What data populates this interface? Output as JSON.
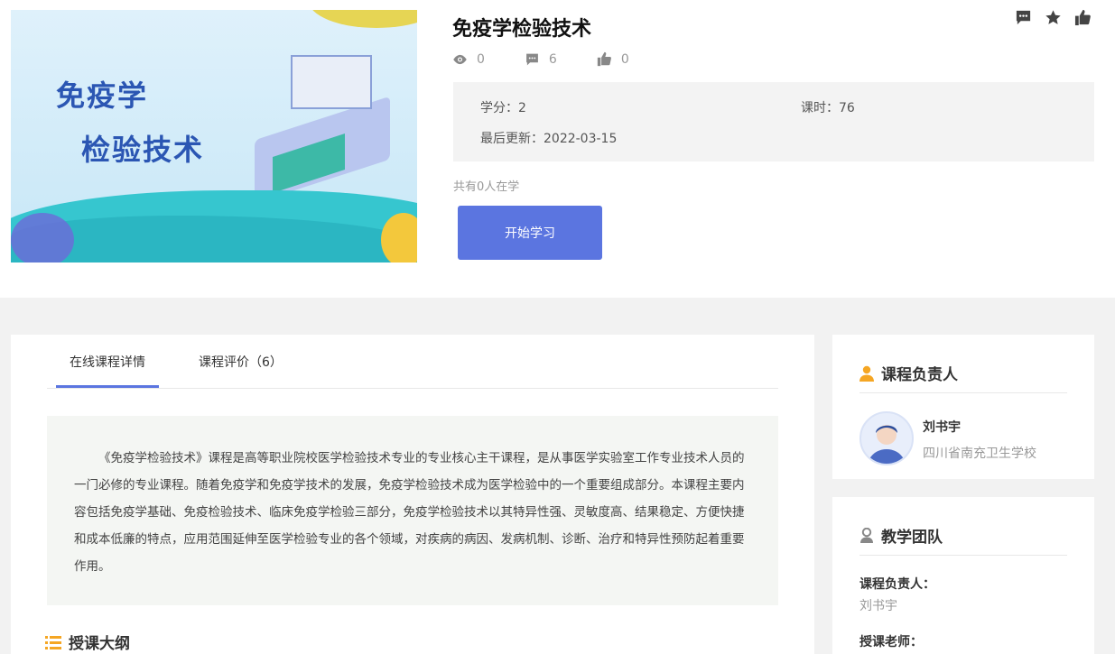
{
  "course": {
    "cover_title_line1": "免疫学",
    "cover_title_line2": "检验技术",
    "title": "免疫学检验技术",
    "stats": {
      "views": "0",
      "comments": "6",
      "likes": "0"
    },
    "credits_label": "学分：2",
    "hours_label": "课时：76",
    "updated_label": "最后更新：2022-03-15",
    "learners_text": "共有0人在学",
    "start_button": "开始学习"
  },
  "tabs": [
    {
      "label": "在线课程详情"
    },
    {
      "label": "课程评价（6）"
    }
  ],
  "description": "《免疫学检验技术》课程是高等职业院校医学检验技术专业的专业核心主干课程，是从事医学实验室工作专业技术人员的一门必修的专业课程。随着免疫学和免疫学技术的发展，免疫学检验技术成为医学检验中的一个重要组成部分。本课程主要内容包括免疫学基础、免疫检验技术、临床免疫学检验三部分，免疫学检验技术以其特异性强、灵敏度高、结果稳定、方便快捷和成本低廉的特点，应用范围延伸至医学检验专业的各个领域，对疾病的病因、发病机制、诊断、治疗和特异性预防起着重要作用。",
  "outline_title": "授课大纲",
  "owner": {
    "heading": "课程负责人",
    "name": "刘书宇",
    "school": "四川省南充卫生学校"
  },
  "team": {
    "heading": "教学团队",
    "owner_label": "课程负责人：",
    "owner_name": "刘书宇",
    "teachers_label": "授课老师："
  },
  "colors": {
    "accent": "#5b75e0",
    "owner_icon": "#f5a623"
  },
  "icons": [
    "eye-icon",
    "comment-icon",
    "thumbs-up-icon",
    "star-icon",
    "user-icon",
    "list-icon"
  ]
}
